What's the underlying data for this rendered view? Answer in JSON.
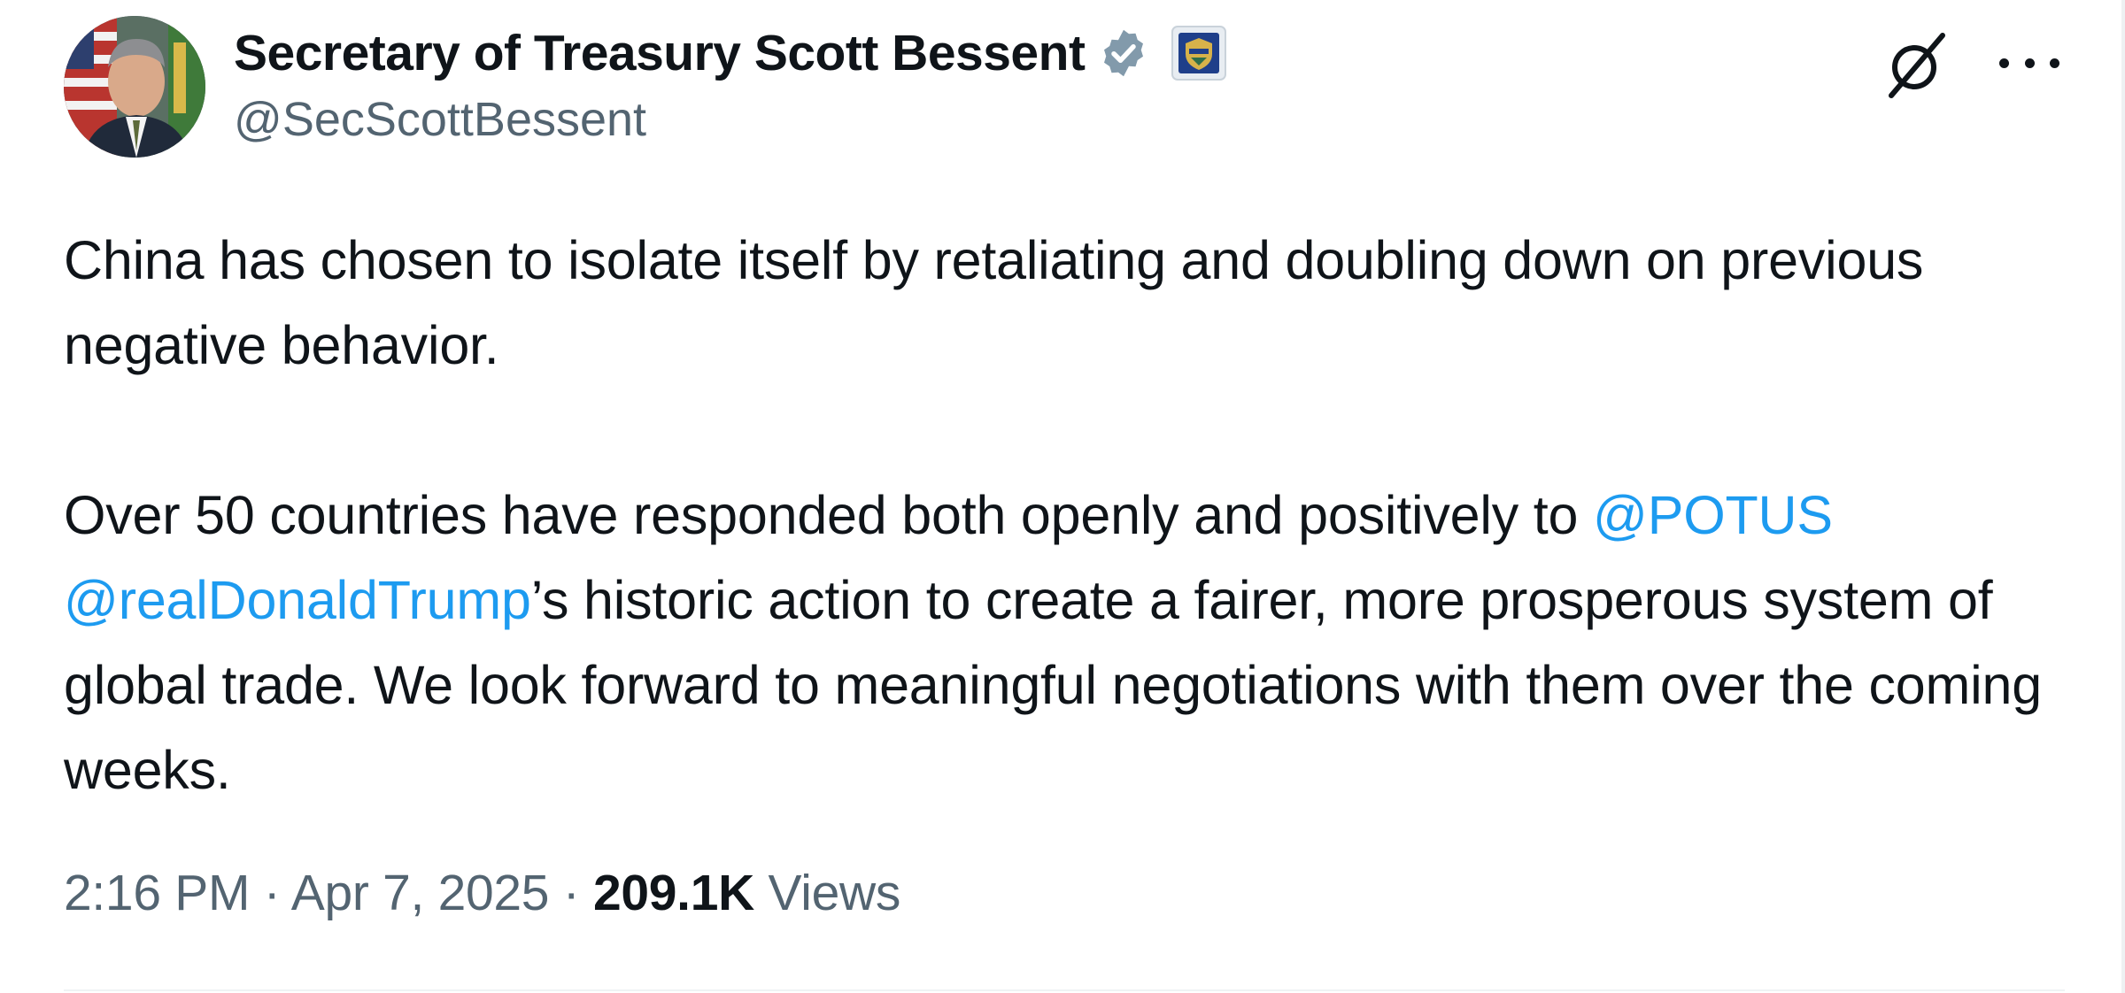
{
  "author": {
    "display_name": "Secretary of Treasury Scott Bessent",
    "handle": "@SecScottBessent",
    "verified_badge_color": "#829aab",
    "affiliate_badge": "treasury-seal-icon"
  },
  "tweet": {
    "paragraph_1": "China has chosen to isolate itself by retaliating and doubling down on previous negative behavior.",
    "paragraph_2_before": "Over 50 countries have responded both openly and positively to ",
    "mention_1": "@POTUS",
    "mention_2": "@realDonaldTrump",
    "paragraph_2_after": "’s historic action to create a fairer, more prosperous system of global trade. We look forward to meaningful negotiations with them over the coming weeks."
  },
  "meta": {
    "time": "2:16 PM",
    "separator": " · ",
    "date": "Apr 7, 2025",
    "views_count": "209.1K",
    "views_label": "Views"
  },
  "colors": {
    "text": "#0f1419",
    "secondary": "#536471",
    "link": "#1d9bf0"
  },
  "icons": {
    "grok": "grok-icon",
    "more": "more-icon"
  }
}
